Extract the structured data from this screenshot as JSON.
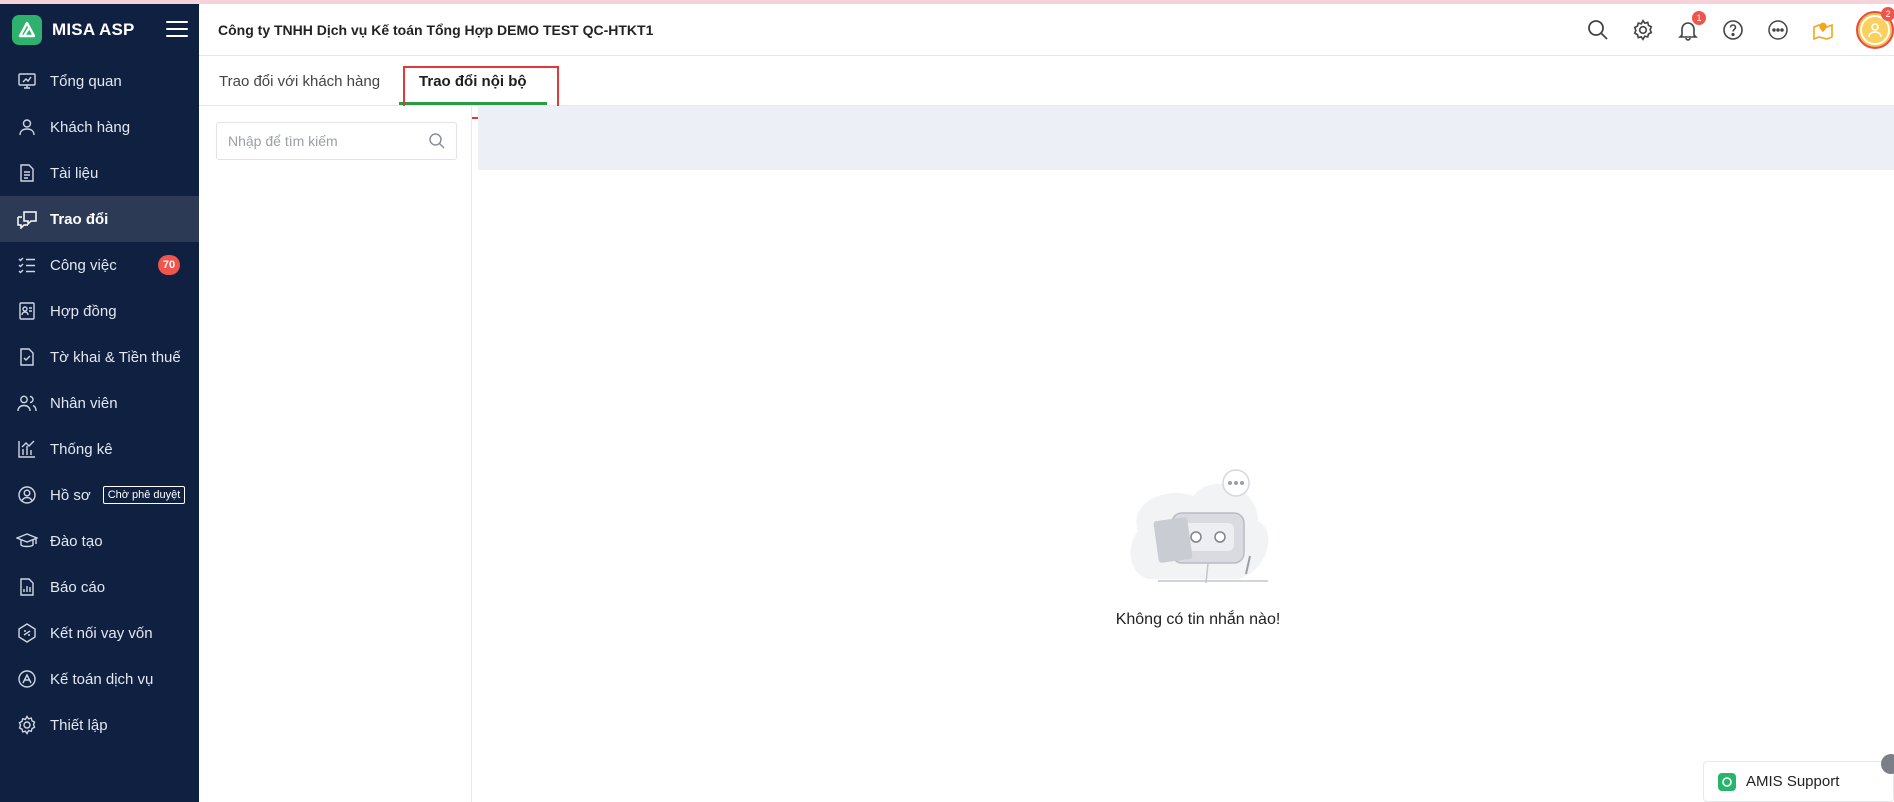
{
  "app": {
    "brand": "MISA ASP",
    "company_title": "Công ty TNHH Dịch vụ Kế toán Tổng Hợp DEMO TEST QC-HTKT1"
  },
  "colors": {
    "sidebar_bg": "#0f2040",
    "accent_green": "#2b9a44",
    "badge_red": "#f0544a",
    "highlight_red": "#e0393a"
  },
  "sidebar": {
    "items": [
      {
        "label": "Tổng quan",
        "icon": "dashboard-icon"
      },
      {
        "label": "Khách hàng",
        "icon": "user-icon"
      },
      {
        "label": "Tài liệu",
        "icon": "document-icon"
      },
      {
        "label": "Trao đổi",
        "icon": "chat-icon",
        "active": true
      },
      {
        "label": "Công việc",
        "icon": "task-list-icon",
        "badge": "70"
      },
      {
        "label": "Hợp đồng",
        "icon": "contract-icon"
      },
      {
        "label": "Tờ khai & Tiền thuế",
        "icon": "tax-form-icon"
      },
      {
        "label": "Nhân viên",
        "icon": "employees-icon"
      },
      {
        "label": "Thống kê",
        "icon": "statistics-icon"
      },
      {
        "label": "Hồ sơ",
        "icon": "profile-icon",
        "tag": "Chờ phê duyệt"
      },
      {
        "label": "Đào tạo",
        "icon": "training-icon"
      },
      {
        "label": "Báo cáo",
        "icon": "report-icon"
      },
      {
        "label": "Kết nối vay vốn",
        "icon": "loan-connect-icon"
      },
      {
        "label": "Kế toán dịch vụ",
        "icon": "accounting-service-icon"
      },
      {
        "label": "Thiết lập",
        "icon": "settings-icon"
      }
    ]
  },
  "header": {
    "notification_count": "1",
    "avatar_badge": "2",
    "icons": [
      "search-icon",
      "gear-icon",
      "bell-icon",
      "help-icon",
      "more-icon",
      "map-pin-icon",
      "avatar"
    ]
  },
  "tabs": [
    {
      "label": "Trao đổi với khách hàng",
      "active": false
    },
    {
      "label": "Trao đổi nội bộ",
      "active": true
    }
  ],
  "search": {
    "placeholder": "Nhập để tìm kiếm",
    "value": ""
  },
  "empty_state": {
    "message": "Không có tin nhắn nào!"
  },
  "support": {
    "label": "AMIS Support"
  }
}
